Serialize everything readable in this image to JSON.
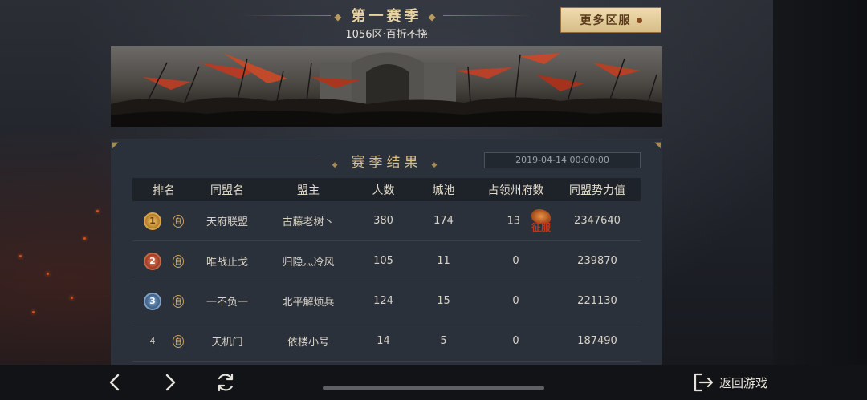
{
  "header": {
    "season_title": "第一赛季",
    "server_subtitle": "1056区·百折不挠",
    "more_servers_label": "更多区服"
  },
  "results": {
    "title": "赛季结果",
    "date": "2019-04-14 00:00:00",
    "columns": [
      "排名",
      "同盟名",
      "盟主",
      "人数",
      "城池",
      "占领州府数",
      "同盟势力值"
    ],
    "self_tag": "自",
    "conquer_label": "征服",
    "rows": [
      {
        "rank": "1",
        "alliance": "天府联盟",
        "leader": "古藤老树丶",
        "members": "380",
        "cities": "174",
        "prefectures": "13",
        "power": "2347640"
      },
      {
        "rank": "2",
        "alliance": "唯战止戈",
        "leader": "归隐灬冷风",
        "members": "105",
        "cities": "11",
        "prefectures": "0",
        "power": "239870"
      },
      {
        "rank": "3",
        "alliance": "一不负一",
        "leader": "北平解烦兵",
        "members": "124",
        "cities": "15",
        "prefectures": "0",
        "power": "221130"
      },
      {
        "rank": "4",
        "alliance": "天机门",
        "leader": "依楼小号",
        "members": "14",
        "cities": "5",
        "prefectures": "0",
        "power": "187490"
      }
    ]
  },
  "bottom": {
    "prev_icon": "chevron-left-icon",
    "next_icon": "chevron-right-icon",
    "refresh_icon": "refresh-icon",
    "exit_label": "返回游戏"
  },
  "colors": {
    "accent_gold": "#e7d3a3",
    "button_bg": "#e6cf9e",
    "panel_bg": "#2b313b"
  }
}
